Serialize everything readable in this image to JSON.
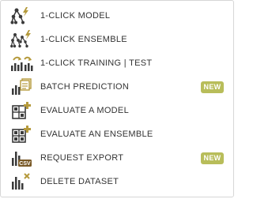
{
  "menu": {
    "items": [
      {
        "label": "1-CLICK MODEL",
        "icon": "model-icon"
      },
      {
        "label": "1-CLICK ENSEMBLE",
        "icon": "ensemble-icon"
      },
      {
        "label": "1-CLICK TRAINING | TEST",
        "icon": "training-test-icon"
      },
      {
        "label": "BATCH PREDICTION",
        "icon": "batch-prediction-icon",
        "badge": "NEW"
      },
      {
        "label": "EVALUATE A MODEL",
        "icon": "evaluate-model-icon"
      },
      {
        "label": "EVALUATE AN ENSEMBLE",
        "icon": "evaluate-ensemble-icon"
      },
      {
        "label": "REQUEST EXPORT",
        "icon": "request-export-icon",
        "icon_text": "CSV",
        "badge": "NEW"
      },
      {
        "label": "DELETE DATASET",
        "icon": "delete-dataset-icon"
      }
    ]
  },
  "colors": {
    "icon_dark": "#3a3a3a",
    "icon_accent": "#b59a3c",
    "badge_bg": "#b8bd5a",
    "text": "#333333"
  }
}
